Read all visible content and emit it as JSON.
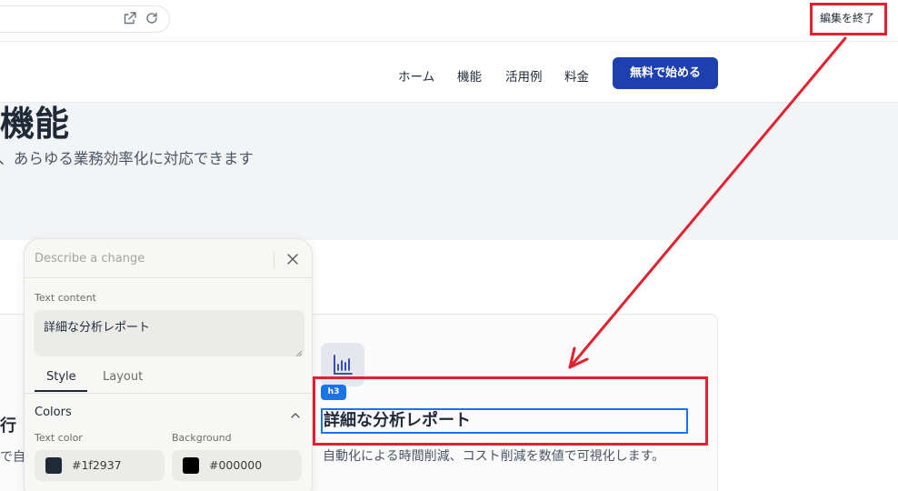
{
  "browser": {
    "edit_toggle_label": "編集を終了"
  },
  "header": {
    "nav": [
      "ホーム",
      "機能",
      "活用例",
      "料金"
    ],
    "cta_label": "無料で始める"
  },
  "hero": {
    "title": "な機能",
    "subtitle": "能で、あらゆる業務効率化に対応できます"
  },
  "card_left": {
    "title": "行",
    "desc": "で自"
  },
  "feature": {
    "tag_badge": "h3",
    "title": "詳細な分析レポート",
    "description": "自動化による時間削減、コスト削減を数値で可視化します。"
  },
  "editor_panel": {
    "prompt_placeholder": "Describe a change",
    "text_content_label": "Text content",
    "text_content_value": "詳細な分析レポート",
    "tabs": [
      "Style",
      "Layout"
    ],
    "active_tab": "Style",
    "section_title": "Colors",
    "text_color_label": "Text color",
    "text_color_value": "#1f2937",
    "background_label": "Background",
    "background_value": "#000000"
  },
  "colors": {
    "cta": "#1e40af",
    "selection": "#1a73e8",
    "annotation": "#e3202f"
  }
}
